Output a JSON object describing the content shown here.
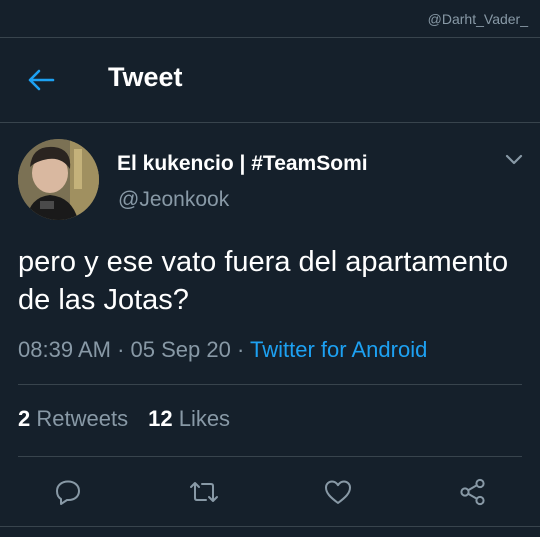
{
  "watermark": "@Darht_Vader_",
  "header": {
    "title": "Tweet",
    "back_icon": "arrow-left-icon"
  },
  "tweet": {
    "display_name": "El kukencio | #TeamSomi",
    "handle": "@Jeonkook",
    "text": "pero y ese vato fuera del apartamento de las Jotas?",
    "time": "08:39 AM",
    "separator": "·",
    "date": "05 Sep 20",
    "source": "Twitter for Android"
  },
  "stats": {
    "retweets_count": "2",
    "retweets_label": "Retweets",
    "likes_count": "12",
    "likes_label": "Likes"
  },
  "actions": [
    "reply-icon",
    "retweet-icon",
    "like-icon",
    "share-icon"
  ],
  "colors": {
    "background": "#15202b",
    "accent": "#1da1f2",
    "muted": "#8899a6",
    "divider": "#38444d"
  }
}
